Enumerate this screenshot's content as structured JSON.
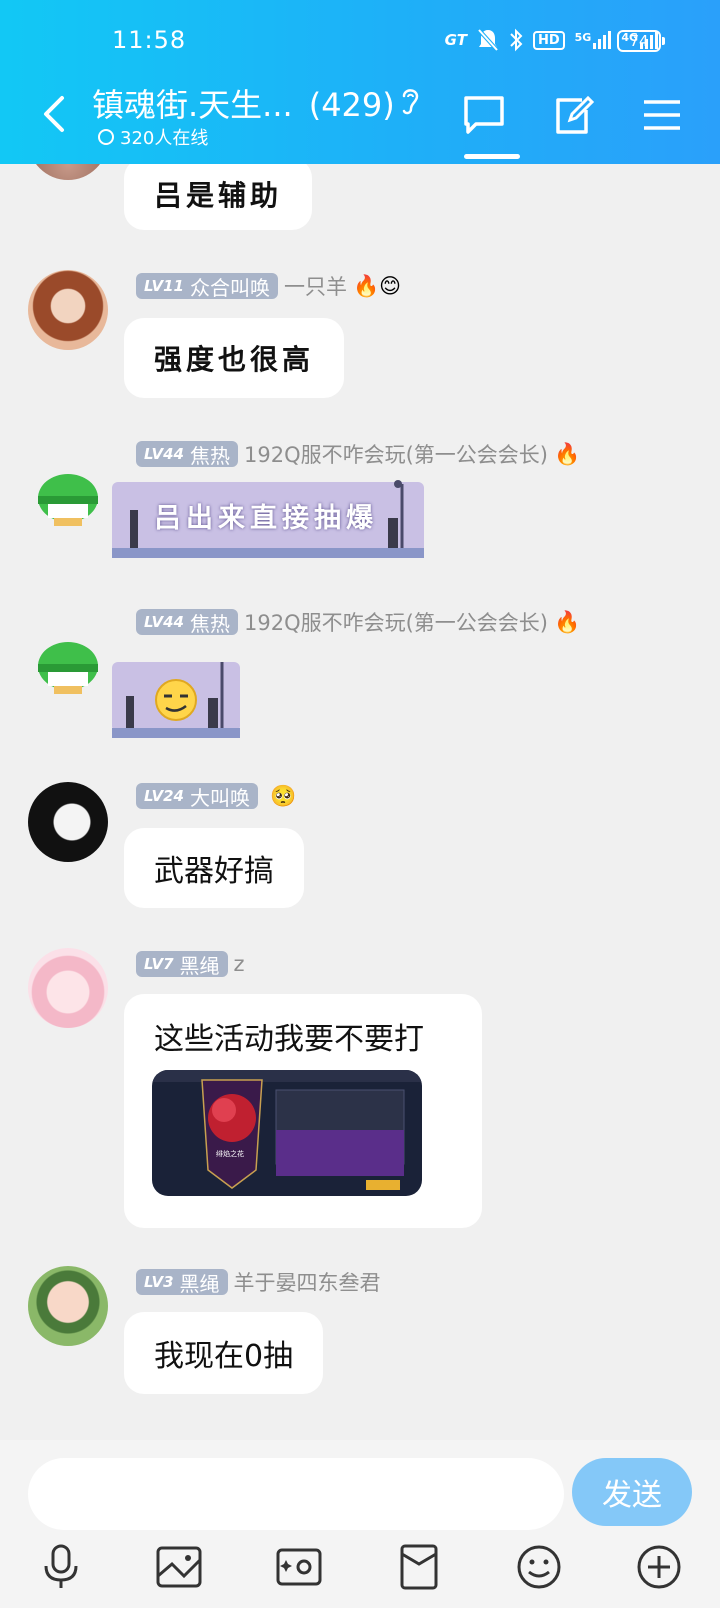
{
  "status_bar": {
    "time": "11:58",
    "network_gt": "GT",
    "hd_label": "HD",
    "net_5g": "5G",
    "net_4g": "4G",
    "battery": "74"
  },
  "header": {
    "title": "镇魂街.天生...",
    "member_count": "(429)",
    "online": "320人在线",
    "accent_color": "#1eb0f8"
  },
  "messages": [
    {
      "text": "吕是辅助"
    },
    {
      "level": "LV11",
      "title": "众合叫唤",
      "nickname": "一只羊",
      "emojis": "🔥😊",
      "text": "强度也很高"
    },
    {
      "level": "LV44",
      "title": "焦热",
      "nickname": "192Q服不咋会玩(第一公会会长)",
      "emojis": "🔥",
      "sticker_text": "吕出来直接抽爆"
    },
    {
      "level": "LV44",
      "title": "焦热",
      "nickname": "192Q服不咋会玩(第一公会会长)",
      "emojis": "🔥",
      "sticker": "smirk-face"
    },
    {
      "level": "LV24",
      "title": "大叫唤",
      "nickname": "",
      "emojis": "🥺",
      "text": "武器好搞"
    },
    {
      "level": "LV7",
      "title": "黑绳",
      "nickname": "z",
      "emojis": "",
      "text": "这些活动我要不要打",
      "screenshot_caption": "绯焰之花"
    },
    {
      "level": "LV3",
      "title": "黑绳",
      "nickname": "羊于晏四东叁君",
      "emojis": "",
      "text": "我现在0抽"
    }
  ],
  "input_bar": {
    "placeholder": "",
    "send_label": "发送",
    "tools": [
      "microphone-icon",
      "image-icon",
      "camera-icon",
      "red-packet-icon",
      "emoji-icon",
      "plus-icon"
    ]
  }
}
